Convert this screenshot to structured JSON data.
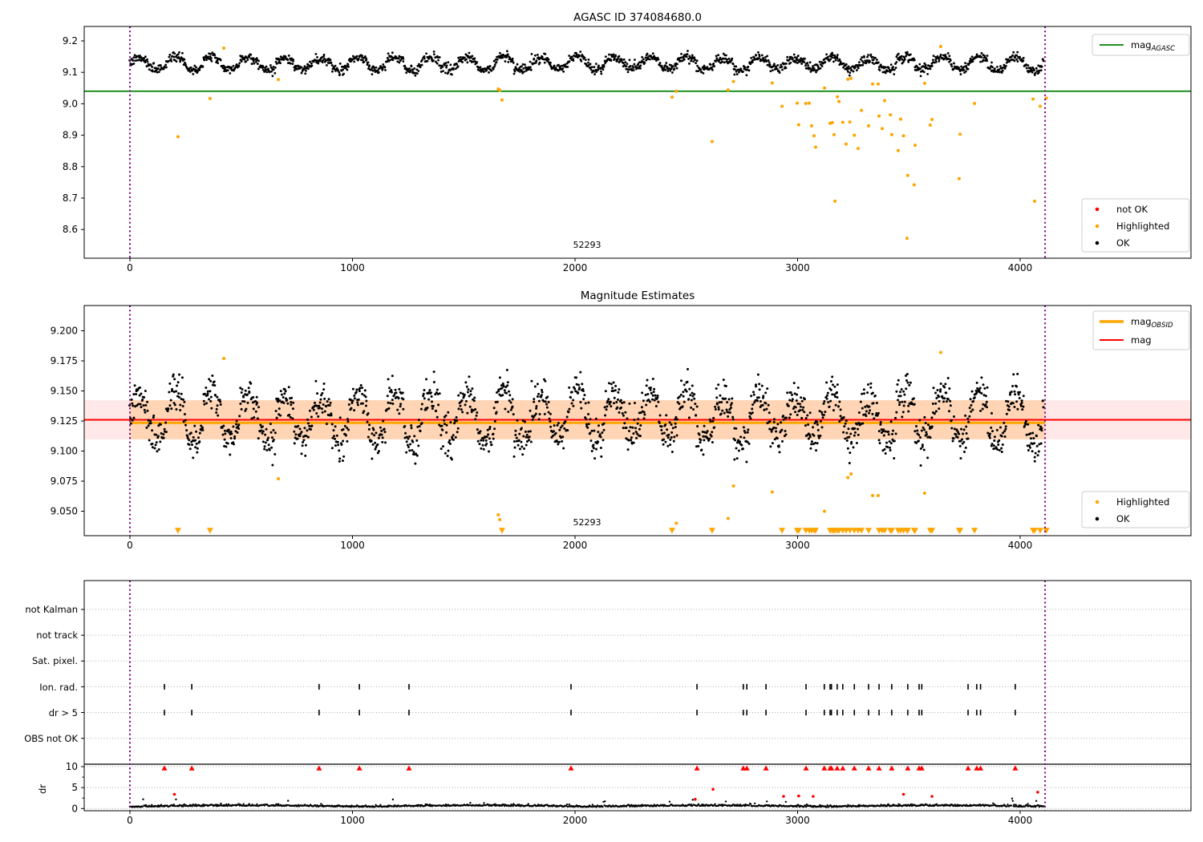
{
  "colors": {
    "ok": "#000000",
    "highlighted": "#FFA500",
    "not_ok": "#FF0000",
    "agasc_line": "#008000",
    "obsid_line": "#FFA500",
    "mag_line": "#FF0000",
    "vline": "#800080",
    "band_pink": "rgba(255,0,0,0.09)",
    "band_orange": "rgba(255,145,0,0.22)",
    "grid": "#AAAAAA",
    "spine": "#000000"
  },
  "chart_data": [
    {
      "type": "scatter",
      "title": "AGASC ID 374084680.0",
      "xlim": [
        -205,
        4768
      ],
      "ylim": [
        8.509,
        9.246
      ],
      "x_ticks": [
        {
          "v": 0,
          "label": "0"
        },
        {
          "v": 1000,
          "label": "1000"
        },
        {
          "v": 2000,
          "label": "2000"
        },
        {
          "v": 3000,
          "label": "3000"
        },
        {
          "v": 4000,
          "label": "4000"
        }
      ],
      "y_ticks": [
        {
          "v": 9.2,
          "label": "9.2"
        },
        {
          "v": 9.1,
          "label": "9.1"
        },
        {
          "v": 9.0,
          "label": "9.0"
        },
        {
          "v": 8.9,
          "label": "8.9"
        },
        {
          "v": 8.8,
          "label": "8.8"
        },
        {
          "v": 8.7,
          "label": "8.7"
        },
        {
          "v": 8.6,
          "label": "8.6"
        }
      ],
      "agasc_line": {
        "y": 9.04,
        "label": "mag",
        "sub": "AGASC"
      },
      "vlines": [
        0,
        4112
      ],
      "legend_points": {
        "items": [
          {
            "label": "not OK",
            "color_key": "not_ok"
          },
          {
            "label": "Highlighted",
            "color_key": "highlighted"
          },
          {
            "label": "OK",
            "color_key": "ok"
          }
        ]
      },
      "obsid_label": "52293",
      "obsid_x": 2055,
      "series_ok_gen": {
        "n": 1750,
        "x_min": 0,
        "x_max": 4105,
        "mean": 9.1285,
        "amp": 0.019,
        "period": 164,
        "noise": 0.0075,
        "dips": [
          [
            635,
            710
          ],
          [
            1655,
            1730
          ]
        ],
        "dip_extra": 0.02
      },
      "highlighted": [
        [
          216,
          8.895
        ],
        [
          360,
          9.017
        ],
        [
          422,
          9.177
        ],
        [
          667,
          9.077
        ],
        [
          1655,
          9.047
        ],
        [
          1662,
          9.043
        ],
        [
          1672,
          9.012
        ],
        [
          2436,
          9.021
        ],
        [
          2455,
          9.04
        ],
        [
          2616,
          8.88
        ],
        [
          2688,
          9.044
        ],
        [
          2712,
          9.071
        ],
        [
          2886,
          9.066
        ],
        [
          2930,
          8.992
        ],
        [
          2998,
          9.002
        ],
        [
          3005,
          8.933
        ],
        [
          3037,
          9.001
        ],
        [
          3052,
          9.002
        ],
        [
          3063,
          8.93
        ],
        [
          3074,
          8.898
        ],
        [
          3081,
          8.862
        ],
        [
          3121,
          9.05
        ],
        [
          3146,
          8.938
        ],
        [
          3156,
          8.94
        ],
        [
          3164,
          8.902
        ],
        [
          3168,
          8.69
        ],
        [
          3179,
          9.022
        ],
        [
          3186,
          9.007
        ],
        [
          3203,
          8.941
        ],
        [
          3218,
          8.872
        ],
        [
          3226,
          9.078
        ],
        [
          3235,
          8.942
        ],
        [
          3240,
          9.081
        ],
        [
          3255,
          8.9
        ],
        [
          3272,
          8.858
        ],
        [
          3287,
          8.979
        ],
        [
          3319,
          8.93
        ],
        [
          3337,
          9.063
        ],
        [
          3362,
          9.063
        ],
        [
          3366,
          8.961
        ],
        [
          3380,
          8.921
        ],
        [
          3391,
          9.01
        ],
        [
          3417,
          8.965
        ],
        [
          3423,
          8.902
        ],
        [
          3452,
          8.851
        ],
        [
          3463,
          8.951
        ],
        [
          3476,
          8.898
        ],
        [
          3492,
          8.572
        ],
        [
          3495,
          8.772
        ],
        [
          3524,
          8.742
        ],
        [
          3528,
          8.868
        ],
        [
          3571,
          9.065
        ],
        [
          3596,
          8.932
        ],
        [
          3604,
          8.95
        ],
        [
          3643,
          9.182
        ],
        [
          3726,
          8.762
        ],
        [
          3730,
          8.903
        ],
        [
          3795,
          9.001
        ],
        [
          4058,
          9.015
        ],
        [
          4065,
          8.69
        ],
        [
          4090,
          8.992
        ],
        [
          4118,
          9.018
        ]
      ]
    },
    {
      "type": "scatter",
      "title": "Magnitude Estimates",
      "xlim": [
        -205,
        4768
      ],
      "ylim": [
        9.03,
        9.221
      ],
      "x_ticks": [
        {
          "v": 0,
          "label": "0"
        },
        {
          "v": 1000,
          "label": "1000"
        },
        {
          "v": 2000,
          "label": "2000"
        },
        {
          "v": 3000,
          "label": "3000"
        },
        {
          "v": 4000,
          "label": "4000"
        }
      ],
      "y_ticks": [
        {
          "v": 9.2,
          "label": "9.200"
        },
        {
          "v": 9.175,
          "label": "9.175"
        },
        {
          "v": 9.15,
          "label": "9.150"
        },
        {
          "v": 9.125,
          "label": "9.125"
        },
        {
          "v": 9.1,
          "label": "9.100"
        },
        {
          "v": 9.075,
          "label": "9.075"
        },
        {
          "v": 9.05,
          "label": "9.050"
        }
      ],
      "mag_line": {
        "y": 9.126,
        "label": "mag"
      },
      "obsid_line": {
        "y": 9.1235,
        "x_start": 0,
        "x_end": 4112,
        "label": "mag",
        "sub": "OBSID"
      },
      "band": {
        "y_low": 9.1097,
        "y_high": 9.1423
      },
      "vlines": [
        0,
        4112
      ],
      "legend_points": {
        "items": [
          {
            "label": "Highlighted",
            "color_key": "highlighted"
          },
          {
            "label": "OK",
            "color_key": "ok"
          }
        ]
      },
      "obsid_label": "52293",
      "obsid_x": 2055,
      "clip_marker_mag": 9.034
    },
    {
      "type": "flags+dr",
      "rows": [
        "not Kalman",
        "not track",
        "Sat. pixel.",
        "Ion. rad.",
        "dr > 5",
        "OBS not OK"
      ],
      "flag_rows": [
        3,
        4
      ],
      "ylabel_dr": "dr",
      "dr_ticks": [
        {
          "v": 10,
          "label": "10"
        },
        {
          "v": 5,
          "label": "5"
        },
        {
          "v": 0,
          "label": "0"
        }
      ],
      "dr_minor_ticks": [
        2.5,
        7.5
      ],
      "x_ticks": [
        {
          "v": 0,
          "label": "0"
        },
        {
          "v": 1000,
          "label": "1000"
        },
        {
          "v": 2000,
          "label": "2000"
        },
        {
          "v": 3000,
          "label": "3000"
        },
        {
          "v": 4000,
          "label": "4000"
        }
      ],
      "vlines": [
        0,
        4112
      ],
      "flag_x": [
        155,
        278,
        850,
        1031,
        1254,
        1982,
        2548,
        2756,
        2772,
        2858,
        3038,
        3120,
        3146,
        3152,
        3178,
        3203,
        3255,
        3319,
        3366,
        3423,
        3495,
        3546,
        3558,
        3766,
        3805,
        3822,
        3978
      ],
      "dr_clipped_x": [
        155,
        278,
        850,
        1031,
        1254,
        1982,
        2548,
        2756,
        2772,
        2858,
        3038,
        3120,
        3146,
        3152,
        3178,
        3203,
        3255,
        3319,
        3366,
        3423,
        3495,
        3546,
        3558,
        3766,
        3805,
        3822,
        3978
      ],
      "dr_red_points": [
        [
          200,
          3.4
        ],
        [
          2540,
          2.2
        ],
        [
          2620,
          4.6
        ],
        [
          2937,
          2.9
        ],
        [
          3005,
          3.0
        ],
        [
          3070,
          2.9
        ],
        [
          3476,
          3.4
        ],
        [
          3604,
          2.9
        ],
        [
          4079,
          3.9
        ]
      ],
      "dr_trace_gen": {
        "n": 1250,
        "x_min": 0,
        "x_max": 4108,
        "base": 0.48,
        "wobble": 0.28,
        "noise": 0.2,
        "spike_p": 0.012,
        "spike_max": 1.8
      }
    }
  ]
}
